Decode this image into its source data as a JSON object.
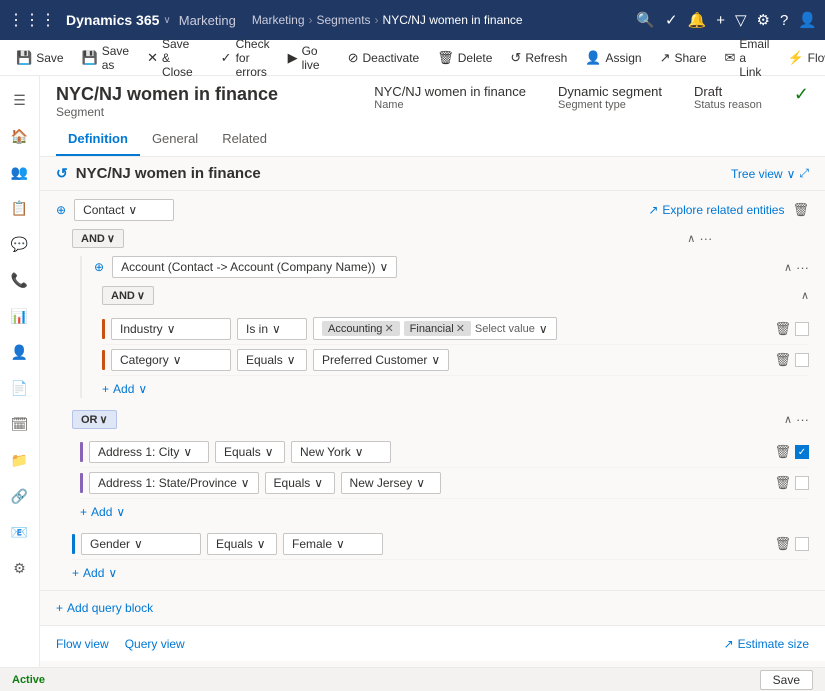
{
  "app": {
    "waffle": "⋮⋮⋮",
    "name": "Dynamics 365",
    "chevron": "∨",
    "nav_marketing": "Marketing",
    "breadcrumb": [
      "Marketing",
      "Segments",
      "NYC/NJ women in finance"
    ],
    "icons": {
      "search": "🔍",
      "check": "✓",
      "bell": "🔔",
      "plus": "+",
      "filter": "▽",
      "settings": "⚙",
      "help": "?",
      "user": "👤"
    }
  },
  "command_bar": {
    "buttons": [
      {
        "label": "Save",
        "icon": "💾"
      },
      {
        "label": "Save as",
        "icon": "💾"
      },
      {
        "label": "Save & Close",
        "icon": "✕"
      },
      {
        "label": "Check for errors",
        "icon": "✓"
      },
      {
        "label": "Go live",
        "icon": "▶"
      },
      {
        "label": "Deactivate",
        "icon": "⊘"
      },
      {
        "label": "Delete",
        "icon": "🗑"
      },
      {
        "label": "Refresh",
        "icon": "↺"
      },
      {
        "label": "Assign",
        "icon": "👤"
      },
      {
        "label": "Share",
        "icon": "↗"
      },
      {
        "label": "Email a Link",
        "icon": "✉"
      },
      {
        "label": "Flow",
        "icon": "⚡"
      }
    ]
  },
  "page_header": {
    "title": "NYC/NJ women in finance",
    "subtitle": "Segment",
    "meta": {
      "name": {
        "value": "NYC/NJ women in finance",
        "label": "Name"
      },
      "type": {
        "value": "Dynamic segment",
        "label": "Segment type"
      },
      "status": {
        "value": "Draft",
        "label": "Status reason"
      }
    },
    "tabs": [
      "Definition",
      "General",
      "Related"
    ]
  },
  "editor": {
    "title": "NYC/NJ women in finance",
    "icon": "↺",
    "view_toggle": "Tree view",
    "view_chevron": "∨",
    "expand_icon": "⤢"
  },
  "query": {
    "entity": "Contact",
    "entity_chevron": "∨",
    "explore_label": "Explore related entities",
    "operator_and": "AND",
    "operator_or": "OR",
    "nested_entity": "Account (Contact -> Account (Company Name))",
    "nested_chevron": "∨",
    "conditions": [
      {
        "type": "orange",
        "field": "Industry",
        "field_chevron": "∨",
        "operator": "Is in",
        "op_chevron": "∨",
        "values": [
          "Accounting",
          "Financial"
        ],
        "select_value": "Select value",
        "checked": false
      },
      {
        "type": "orange",
        "field": "Category",
        "field_chevron": "∨",
        "operator": "Equals",
        "op_chevron": "∨",
        "value": "Preferred Customer",
        "value_chevron": "∨",
        "checked": false
      }
    ],
    "add_label": "Add",
    "or_block": {
      "operator": "OR",
      "conditions": [
        {
          "type": "purple",
          "field": "Address 1: City",
          "field_chevron": "∨",
          "operator": "Equals",
          "op_chevron": "∨",
          "value": "New York",
          "value_chevron": "∨",
          "checked": true
        },
        {
          "type": "purple",
          "field": "Address 1: State/Province",
          "field_chevron": "∨",
          "operator": "Equals",
          "op_chevron": "∨",
          "value": "New Jersey",
          "value_chevron": "∨",
          "checked": false
        }
      ],
      "add_label": "Add"
    },
    "gender_condition": {
      "type": "blue",
      "field": "Gender",
      "field_chevron": "∨",
      "operator": "Equals",
      "op_chevron": "∨",
      "value": "Female",
      "value_chevron": "∨",
      "checked": false
    },
    "root_add_label": "Add",
    "add_query_block": "Add query block"
  },
  "bottom": {
    "flow_view": "Flow view",
    "query_view": "Query view",
    "estimate_label": "Estimate size",
    "estimate_icon": "↗"
  },
  "status_bar": {
    "status": "Active",
    "save_label": "Save"
  },
  "sidebar_icons": [
    "≡",
    "🏠",
    "👥",
    "📋",
    "💬",
    "🔔",
    "⚙",
    "📊",
    "🗓",
    "📁",
    "🔗",
    "📧",
    "⚙"
  ]
}
